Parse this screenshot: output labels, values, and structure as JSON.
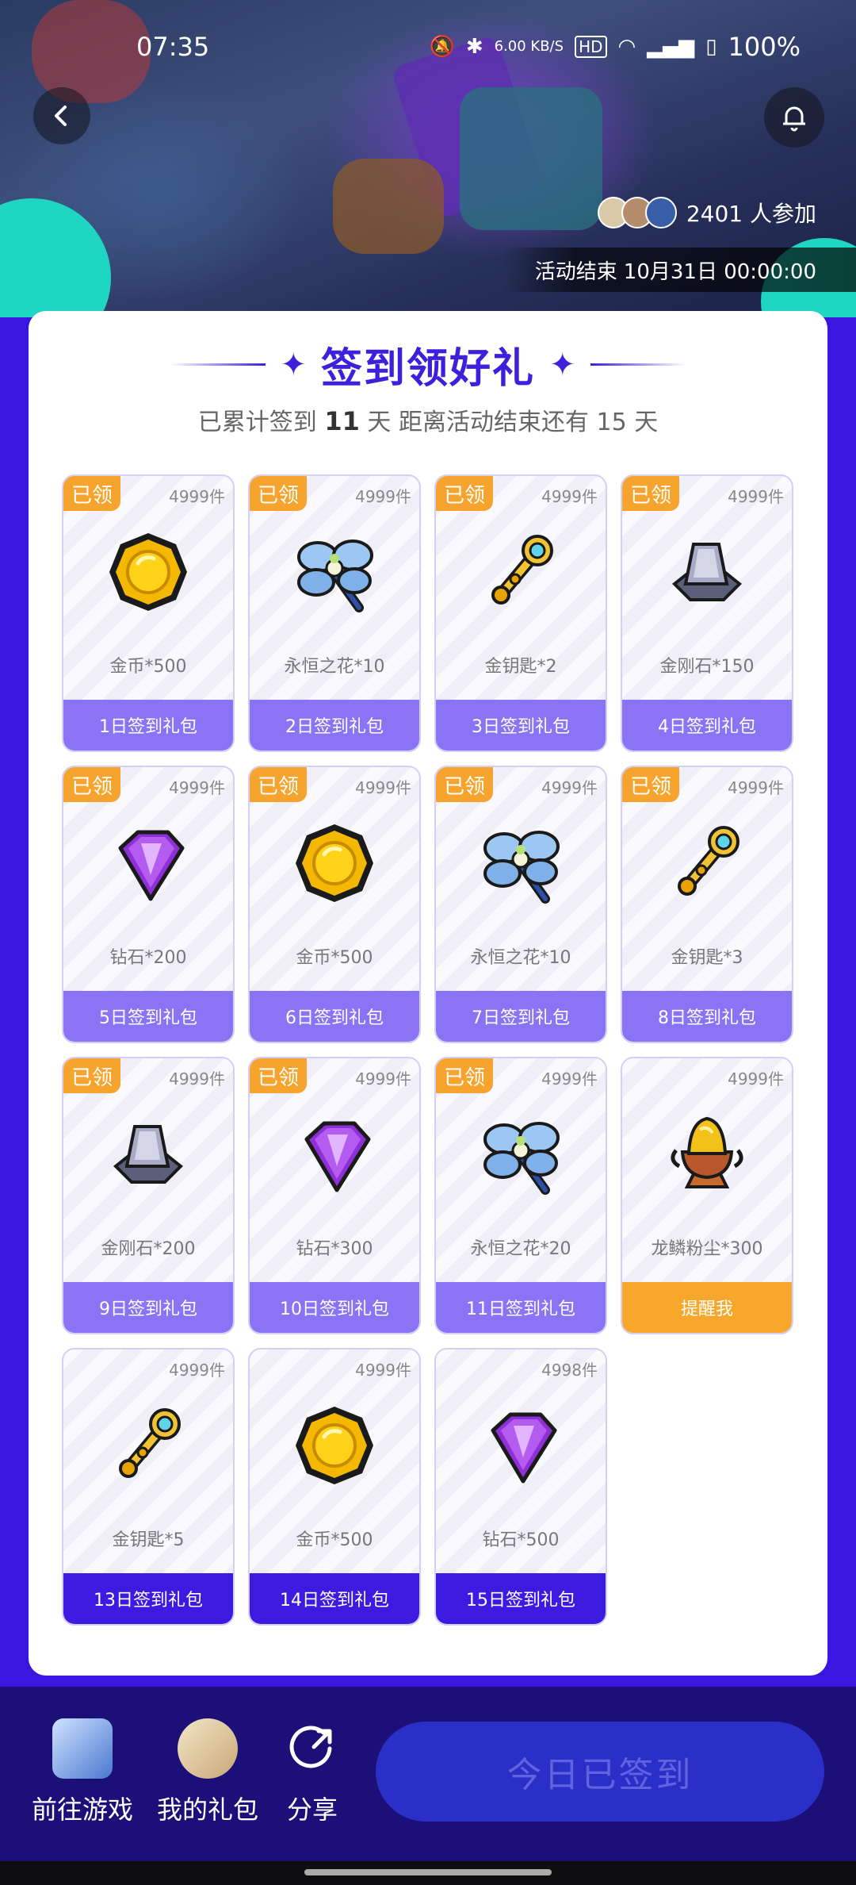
{
  "status_bar": {
    "time": "07:35",
    "net_speed": "6.00 KB/S",
    "hd_label": "HD",
    "battery": "100%"
  },
  "header": {
    "participants_count": "2401 人参加",
    "end_label": "活动结束",
    "end_time": "10月31日 00:00:00"
  },
  "card": {
    "title": "签到领好礼",
    "subtitle_pre": "已累计签到",
    "signed_days": "11",
    "subtitle_mid": "天  距离活动结束还有 15 天"
  },
  "gifts": [
    {
      "status": "received",
      "badge": "已领",
      "stock": "4999件",
      "name": "金币*500",
      "button": "1日签到礼包",
      "icon": "gold-coin"
    },
    {
      "status": "received",
      "badge": "已领",
      "stock": "4999件",
      "name": "永恒之花*10",
      "button": "2日签到礼包",
      "icon": "eternal-flower"
    },
    {
      "status": "received",
      "badge": "已领",
      "stock": "4999件",
      "name": "金钥匙*2",
      "button": "3日签到礼包",
      "icon": "golden-key"
    },
    {
      "status": "received",
      "badge": "已领",
      "stock": "4999件",
      "name": "金刚石*150",
      "button": "4日签到礼包",
      "icon": "adamant-ingot"
    },
    {
      "status": "received",
      "badge": "已领",
      "stock": "4999件",
      "name": "钻石*200",
      "button": "5日签到礼包",
      "icon": "diamond"
    },
    {
      "status": "received",
      "badge": "已领",
      "stock": "4999件",
      "name": "金币*500",
      "button": "6日签到礼包",
      "icon": "gold-coin"
    },
    {
      "status": "received",
      "badge": "已领",
      "stock": "4999件",
      "name": "永恒之花*10",
      "button": "7日签到礼包",
      "icon": "eternal-flower"
    },
    {
      "status": "received",
      "badge": "已领",
      "stock": "4999件",
      "name": "金钥匙*3",
      "button": "8日签到礼包",
      "icon": "golden-key"
    },
    {
      "status": "received",
      "badge": "已领",
      "stock": "4999件",
      "name": "金刚石*200",
      "button": "9日签到礼包",
      "icon": "adamant-ingot"
    },
    {
      "status": "received",
      "badge": "已领",
      "stock": "4999件",
      "name": "钻石*300",
      "button": "10日签到礼包",
      "icon": "diamond"
    },
    {
      "status": "received",
      "badge": "已领",
      "stock": "4999件",
      "name": "永恒之花*20",
      "button": "11日签到礼包",
      "icon": "eternal-flower"
    },
    {
      "status": "remind",
      "badge": "",
      "stock": "4999件",
      "name": "龙鳞粉尘*300",
      "button": "提醒我",
      "icon": "dragon-scale-dust"
    },
    {
      "status": "pending",
      "badge": "",
      "stock": "4999件",
      "name": "金钥匙*5",
      "button": "13日签到礼包",
      "icon": "golden-key"
    },
    {
      "status": "pending",
      "badge": "",
      "stock": "4999件",
      "name": "金币*500",
      "button": "14日签到礼包",
      "icon": "gold-coin"
    },
    {
      "status": "pending",
      "badge": "",
      "stock": "4998件",
      "name": "钻石*500",
      "button": "15日签到礼包",
      "icon": "diamond"
    }
  ],
  "bottom_nav": {
    "game_label": "前往游戏",
    "gift_label": "我的礼包",
    "share_label": "分享",
    "checkin_label": "今日已签到"
  },
  "colors": {
    "primary": "#3c20dc",
    "received": "#8a73f4",
    "remind": "#f7a82c",
    "badge": "#f6a42d",
    "bottom_bar": "#1c0f78"
  }
}
